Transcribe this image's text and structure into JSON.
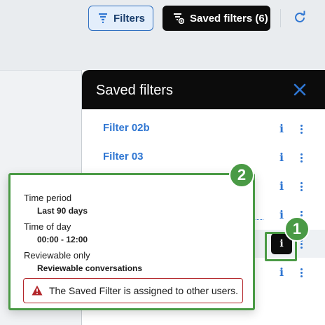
{
  "toolbar": {
    "filters_label": "Filters",
    "saved_filters_label": "Saved filters (6)"
  },
  "panel": {
    "title": "Saved filters",
    "items": [
      {
        "name": "Filter 02b"
      },
      {
        "name": "Filter 03"
      },
      {
        "name": ""
      },
      {
        "name": ""
      },
      {
        "name": ""
      },
      {
        "name": ""
      }
    ]
  },
  "tooltip": {
    "fields": [
      {
        "label": "Time period",
        "value": "Last 90 days"
      },
      {
        "label": "Time of day",
        "value": "00:00 - 12:00"
      },
      {
        "label": "Reviewable only",
        "value": "Reviewable conversations"
      }
    ],
    "alert": "The Saved Filter is assigned to other users."
  },
  "annotations": {
    "badge_1": "1",
    "badge_2": "2"
  },
  "colors": {
    "accent": "#2f76d2",
    "annotation": "#4a9a45",
    "alert": "#b3262a",
    "dark": "#0c0c0c"
  }
}
